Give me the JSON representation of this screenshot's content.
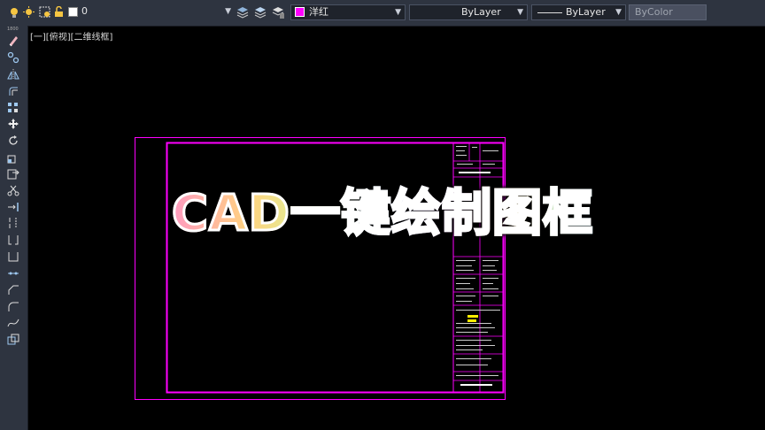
{
  "toolbar": {
    "layer_name": "0",
    "color_layer_name": "洋红",
    "color_layer_swatch": "#ff00ff",
    "color_value": "ByLayer",
    "linetype_value": "ByLayer",
    "plotstyle_value": "ByColor"
  },
  "sidebar": {
    "header": "1800",
    "icons": [
      "erase-icon",
      "copy-icon",
      "mirror-icon",
      "offset-icon",
      "array-icon",
      "move-icon",
      "rotate-icon",
      "scale-icon",
      "stretch-icon",
      "trim-icon",
      "extend-icon",
      "break-at-point-icon",
      "break-icon",
      "join-icon",
      "chamfer-icon",
      "fillet-icon",
      "blend-icon",
      "explode-icon"
    ]
  },
  "viewport": {
    "label": "[一][俯视][二维线框]"
  },
  "overlay": {
    "title": "CAD一键绘制图框"
  },
  "colors": {
    "frame": "#ff00ff",
    "background": "#000000",
    "title_block_text": "#ffffff",
    "highlight": "#ffee00"
  }
}
